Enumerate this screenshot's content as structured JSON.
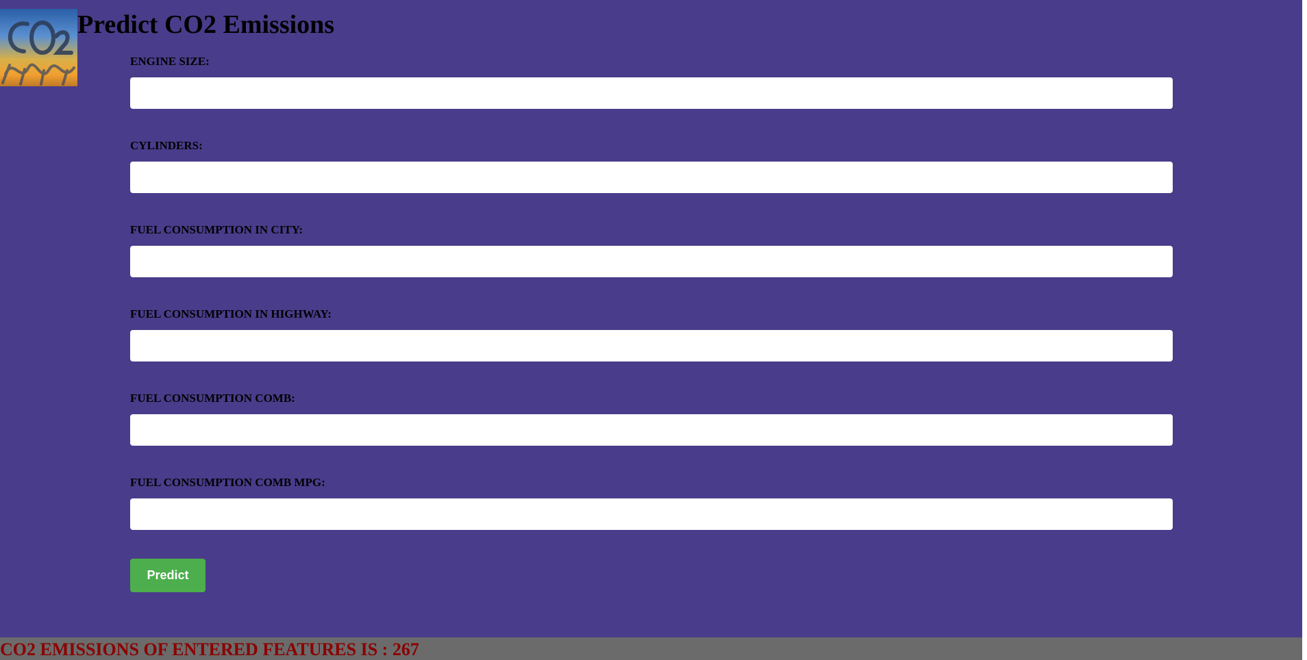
{
  "header": {
    "title": "Predict CO2 Emissions",
    "logo_icon": "co2-logo-icon",
    "logo_text": "CO2"
  },
  "form": {
    "fields": [
      {
        "label": "ENGINE SIZE:",
        "value": "",
        "placeholder": ""
      },
      {
        "label": "CYLINDERS:",
        "value": "",
        "placeholder": ""
      },
      {
        "label": "FUEL CONSUMPTION IN CITY:",
        "value": "",
        "placeholder": ""
      },
      {
        "label": "FUEL CONSUMPTION IN HIGHWAY:",
        "value": "",
        "placeholder": ""
      },
      {
        "label": "FUEL CONSUMPTION COMB:",
        "value": "",
        "placeholder": ""
      },
      {
        "label": "FUEL CONSUMPTION COMB MPG:",
        "value": "",
        "placeholder": ""
      }
    ],
    "submit_label": "Predict"
  },
  "result": {
    "text": "CO2 EMISSIONS OF ENTERED FEATURES IS : 267"
  },
  "colors": {
    "background": "#493c8a",
    "button": "#4cae4c",
    "result_bar": "#6b6b6b",
    "result_text": "#8b0000"
  }
}
